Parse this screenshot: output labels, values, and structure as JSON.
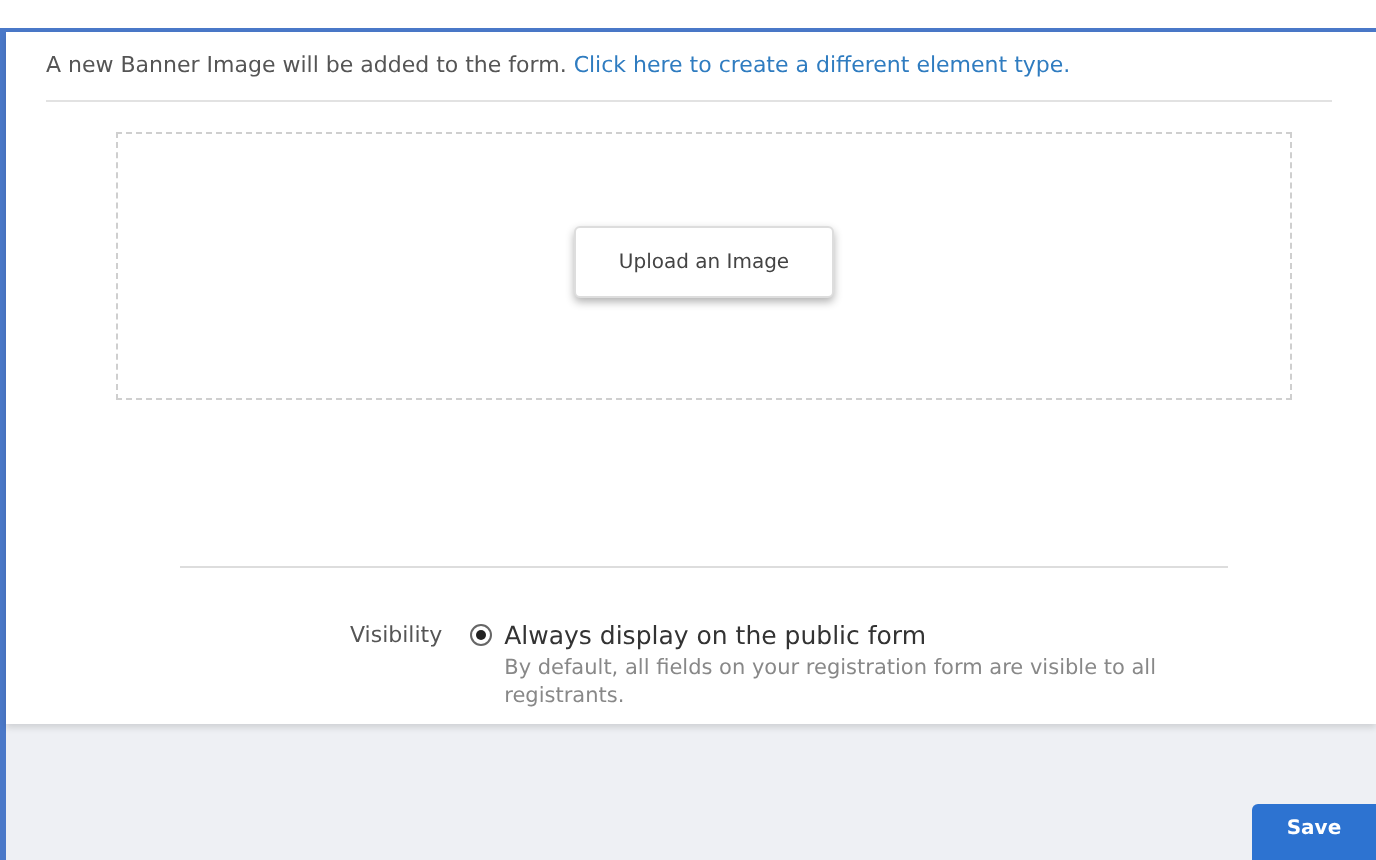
{
  "intro": {
    "text": "A new Banner Image will be added to the form.",
    "link": "Click here to create a different element type."
  },
  "upload_button": "Upload an Image",
  "visibility": {
    "label": "Visibility",
    "options": [
      {
        "label": "Always display on the public form",
        "description": "By default, all fields on your registration form are visible to all registrants.",
        "selected": true
      }
    ]
  },
  "footer": {
    "save_button": "Save"
  }
}
